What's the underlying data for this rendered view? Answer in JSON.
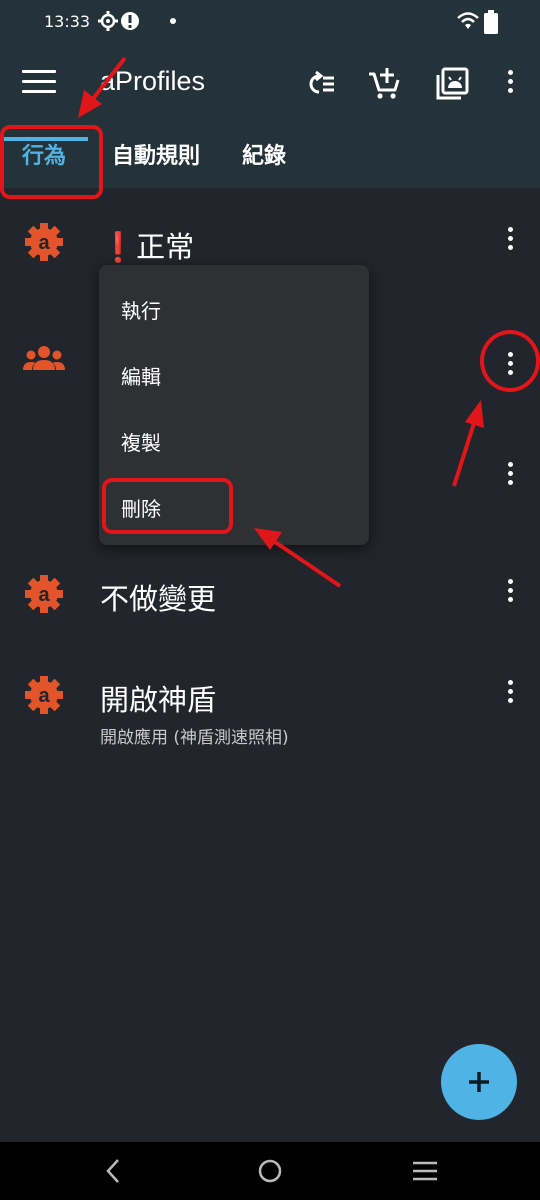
{
  "status_bar": {
    "time": "13:33"
  },
  "app_bar": {
    "title": "aProfiles"
  },
  "tabs": [
    {
      "label": "行為",
      "active": true
    },
    {
      "label": "自動規則",
      "active": false
    },
    {
      "label": "紀錄",
      "active": false
    }
  ],
  "profiles": [
    {
      "title": "❗正常",
      "subtitle": "",
      "icon": "aprofiles-gear-icon"
    },
    {
      "title": "",
      "subtitle": "",
      "icon": "people-icon"
    },
    {
      "title": "",
      "subtitle": "",
      "icon": "moon-icon"
    },
    {
      "title": "不做變更",
      "subtitle": "",
      "icon": "aprofiles-gear-icon"
    },
    {
      "title": "開啟神盾",
      "subtitle": "開啟應用 (神盾測速照相)",
      "icon": "aprofiles-gear-icon"
    }
  ],
  "popup_menu": {
    "items": [
      "執行",
      "編輯",
      "複製",
      "刪除"
    ]
  },
  "colors": {
    "accent": "#4fb3e6",
    "icon_orange": "#e2542a",
    "annotation_red": "#e0161b",
    "appbar_bg": "#243239",
    "list_bg": "#22252b"
  }
}
